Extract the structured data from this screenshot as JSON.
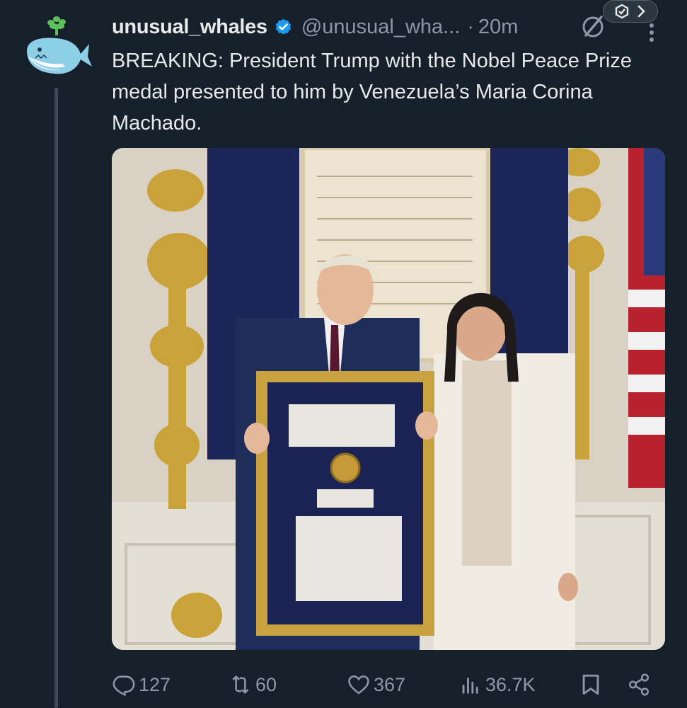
{
  "tweet": {
    "display_name": "unusual_whales",
    "handle": "@unusual_wha...",
    "separator": "·",
    "time": "20m",
    "text": "BREAKING: President Trump with the Nobel Peace Prize medal presented to him by Venezuela’s Maria Corina Machado.",
    "verified": true
  },
  "media": {
    "image_content": "photo"
  },
  "actions": {
    "replies": "127",
    "reposts": "60",
    "likes": "367",
    "views": "36.7K"
  },
  "icons": [
    "whale-avatar-icon",
    "verified-icon",
    "grok-icon",
    "more-icon",
    "reply-icon",
    "repost-icon",
    "like-icon",
    "views-icon",
    "bookmark-icon",
    "share-icon"
  ],
  "colors": {
    "background": "#15202b",
    "primary_text": "#e7e9ea",
    "secondary_text": "#8b98a5",
    "verified_blue": "#1d9bf0"
  }
}
